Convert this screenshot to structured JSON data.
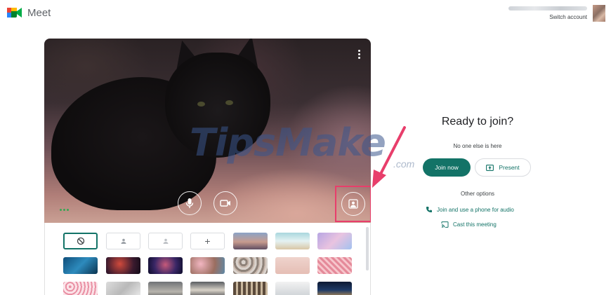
{
  "header": {
    "app_name": "Meet",
    "switch_account": "Switch account"
  },
  "preview": {
    "watermark": "TipsMake",
    "watermark_suffix": ".com",
    "controls": [
      "microphone",
      "camera",
      "change-background"
    ]
  },
  "right_panel": {
    "title": "Ready to join?",
    "subtitle": "No one else is here",
    "join_label": "Join now",
    "present_label": "Present",
    "other_options_label": "Other options",
    "phone_link": "Join and use a phone for audio",
    "cast_link": "Cast this meeting"
  },
  "background_tiles": {
    "row1": [
      "no-effect",
      "slight-blur",
      "blur",
      "add",
      "sunset",
      "beach",
      "pastel-sky"
    ],
    "row2": [
      "ocean",
      "nebula-red",
      "galaxy",
      "cherry-blossom",
      "pebbles",
      "pink-wall",
      "pink-pattern"
    ],
    "row3": [
      "petals",
      "marble",
      "office",
      "room",
      "bookshelf",
      "white-room",
      "city-night"
    ]
  },
  "colors": {
    "accent": "#137367",
    "highlight": "#e83e6b"
  }
}
